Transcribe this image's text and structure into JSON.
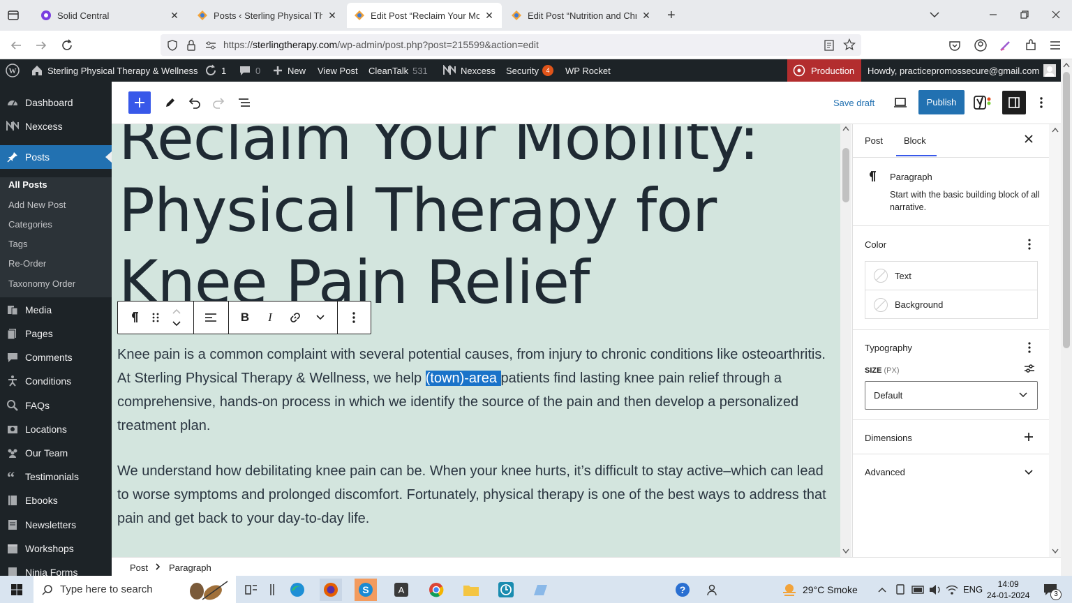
{
  "browser": {
    "tabs": [
      {
        "label": "Solid Central",
        "active": false
      },
      {
        "label": "Posts ‹ Sterling Physical Therapy",
        "active": false
      },
      {
        "label": "Edit Post “Reclaim Your Mobility",
        "active": true
      },
      {
        "label": "Edit Post “Nutrition and Chronic",
        "active": false
      }
    ],
    "url_prefix": "https://",
    "url_domain": "sterlingtherapy.com",
    "url_path": "/wp-admin/post.php?post=215599&action=edit"
  },
  "adminbar": {
    "site_name": "Sterling Physical Therapy & Wellness",
    "updates_count": "1",
    "comments_count": "0",
    "new_label": "New",
    "view_post_label": "View Post",
    "cleantalk_label": "CleanTalk",
    "cleantalk_count": "531",
    "nexcess_label": "Nexcess",
    "security_label": "Security",
    "security_count": "4",
    "wprocket_label": "WP Rocket",
    "production_label": "Production",
    "howdy_label": "Howdy, practicepromossecure@gmail.com"
  },
  "sidebar": {
    "items": [
      {
        "label": "Dashboard",
        "icon": "dashboard-icon"
      },
      {
        "label": "Nexcess",
        "icon": "nexcess-icon"
      },
      {
        "label": "Posts",
        "icon": "pin-icon"
      },
      {
        "label": "Media",
        "icon": "media-icon"
      },
      {
        "label": "Pages",
        "icon": "page-icon"
      },
      {
        "label": "Comments",
        "icon": "comment-icon"
      },
      {
        "label": "Conditions",
        "icon": "figure-icon"
      },
      {
        "label": "FAQs",
        "icon": "faq-icon"
      },
      {
        "label": "Locations",
        "icon": "location-icon"
      },
      {
        "label": "Our Team",
        "icon": "team-icon"
      },
      {
        "label": "Testimonials",
        "icon": "quote-icon"
      },
      {
        "label": "Ebooks",
        "icon": "book-icon"
      },
      {
        "label": "Newsletters",
        "icon": "newsletter-icon"
      },
      {
        "label": "Workshops",
        "icon": "workshop-icon"
      },
      {
        "label": "Ninja Forms",
        "icon": "form-icon"
      }
    ],
    "submenu": [
      "All Posts",
      "Add New Post",
      "Categories",
      "Tags",
      "Re-Order",
      "Taxonomy Order"
    ]
  },
  "editor": {
    "save_draft_label": "Save draft",
    "publish_label": "Publish",
    "title": "Reclaim Your Mobility: Physical Therapy for Knee Pain Relief",
    "para1_before": "Knee pain is a common complaint with several potential causes, from injury to chronic conditions like osteoarthritis. At Sterling Physical Therapy & Wellness, we help ",
    "para1_highlight": "(town)-area ",
    "para1_after": "patients find lasting knee pain relief through a comprehensive, hands-on process in which we identify the source of the pain and then develop a personalized treatment plan.",
    "para2": "We understand how debilitating knee pain can be. When your knee hurts, it’s difficult to stay active–which can lead to worse symptoms and prolonged discomfort. Fortunately, physical therapy is one of the best ways to address that pain and get back to your day-to-day life.",
    "breadcrumb": [
      "Post",
      "Paragraph"
    ]
  },
  "inspector": {
    "tab_post": "Post",
    "tab_block": "Block",
    "block_name": "Paragraph",
    "block_desc": "Start with the basic building block of all narrative.",
    "color_title": "Color",
    "color_text": "Text",
    "color_background": "Background",
    "typography_title": "Typography",
    "size_label": "SIZE",
    "size_unit": "(PX)",
    "size_value": "Default",
    "dimensions_title": "Dimensions",
    "advanced_title": "Advanced"
  },
  "taskbar": {
    "search_placeholder": "Type here to search",
    "weather": "29°C  Smoke",
    "lang": "ENG",
    "time": "14:09",
    "date": "24-01-2024",
    "notifications": "3"
  },
  "colors": {
    "wp_dark": "#1d2327",
    "wp_blue": "#2271b1",
    "wp_admin_blue": "#3858e9",
    "canvas_bg": "#d3e5de",
    "production_red": "#b32d2e"
  }
}
